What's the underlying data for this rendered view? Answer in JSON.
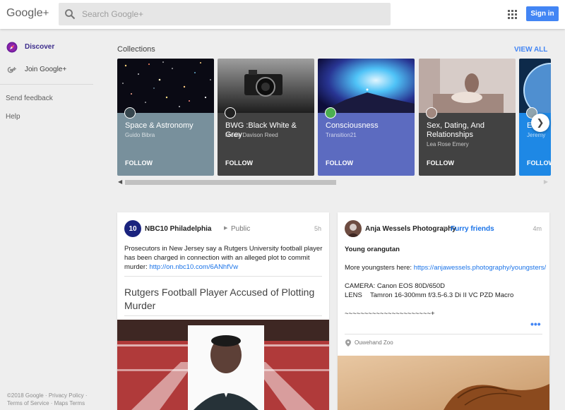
{
  "header": {
    "logo_text": "Google",
    "logo_plus": "+",
    "search_placeholder": "Search Google+",
    "signin_label": "Sign in"
  },
  "sidebar": {
    "items": [
      {
        "label": "Discover",
        "icon": "compass-icon",
        "active": true
      },
      {
        "label": "Join Google+",
        "icon": "google-plus-icon",
        "active": false
      }
    ],
    "feedback": "Send feedback",
    "help": "Help",
    "footer_line1": "©2018 Google · Privacy Policy ·",
    "footer_line2": "Terms of Service · Maps Terms"
  },
  "collections": {
    "title": "Collections",
    "view_all": "VIEW ALL",
    "items": [
      {
        "title": "Space & Astronomy",
        "author": "Guido Bibra",
        "follow": "FOLLOW",
        "color": "#78909c"
      },
      {
        "title": "BWG :Black White & Grey",
        "author": "Nicola Davison Reed",
        "follow": "FOLLOW",
        "color": "#424242"
      },
      {
        "title": "Consciousness",
        "author": "Transition21",
        "follow": "FOLLOW",
        "color": "#5c6bc0"
      },
      {
        "title": "Sex, Dating, And Relationships",
        "author": "Lea Rose Emery",
        "follow": "FOLLOW",
        "color": "#424242"
      },
      {
        "title": "E",
        "author": "Jeremy",
        "follow": "FOLLOW",
        "color": "#1e88e5"
      }
    ]
  },
  "posts": [
    {
      "author": "NBC10 Philadelphia",
      "audience": "Public",
      "time": "5h",
      "text": "Prosecutors in New Jersey say a Rutgers University football player has been charged in connection with an alleged plot to commit murder: ",
      "link": "http://on.nbc10.com/6ANhfVw",
      "headline": "Rutgers Football Player Accused of Plotting Murder"
    },
    {
      "author": "Anja Wessels Photography",
      "audience": "Furry friends",
      "time": "4m",
      "title": "Young orangutan",
      "more_text": "More youngsters here: ",
      "link": "https://anjawessels.photography/youngsters/",
      "camera": "CAMERA: Canon EOS 80D/650D",
      "lens_label": "LENS",
      "lens_value": "Tamron 16-300mm f/3.5-6.3 Di II VC PZD Macro",
      "tildes": "~~~~~~~~~~~~~~~~~~~~~~+",
      "more": "•••",
      "location": "Ouwehand Zoo"
    }
  ]
}
